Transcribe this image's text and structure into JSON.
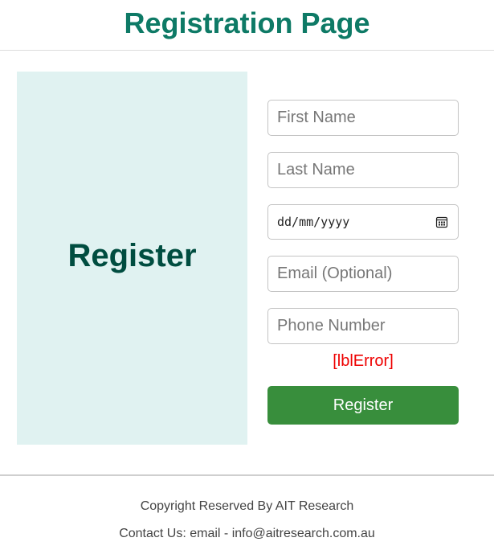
{
  "header": {
    "title": "Registration Page"
  },
  "side_panel": {
    "title": "Register"
  },
  "form": {
    "first_name": {
      "placeholder": "First Name",
      "value": ""
    },
    "last_name": {
      "placeholder": "Last Name",
      "value": ""
    },
    "dob": {
      "placeholder": "dd/mm/yyyy",
      "icon": "calendar-icon"
    },
    "email": {
      "placeholder": "Email (Optional)",
      "value": ""
    },
    "phone": {
      "placeholder": "Phone Number",
      "value": ""
    },
    "error_label": "[lblError]",
    "submit_label": "Register"
  },
  "footer": {
    "copyright": "Copyright Reserved By AIT Research",
    "contact": "Contact Us: email - info@aitresearch.com.au"
  },
  "colors": {
    "title": "#0e7a66",
    "panel_bg": "#e0f2f1",
    "panel_text": "#004d40",
    "error": "#ee0000",
    "button": "#388e3c"
  }
}
